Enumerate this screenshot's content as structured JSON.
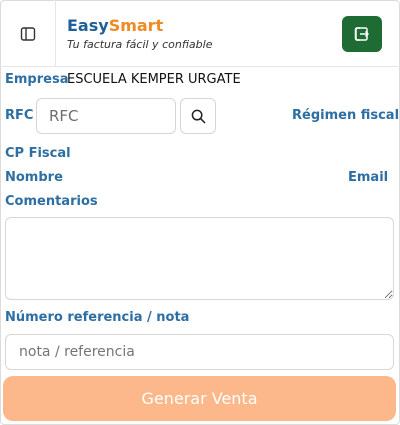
{
  "header": {
    "brand_easy": "Easy",
    "brand_smart": "Smart",
    "tagline": "Tu factura fácil y confiable",
    "toggle_icon": "sidebar-toggle-icon",
    "logout_icon": "logout-icon"
  },
  "form": {
    "empresa_label": "Empresa",
    "empresa_value": "ESCUELA KEMPER URGATE",
    "rfc_label": "RFC",
    "rfc_placeholder": "RFC",
    "regimen_label": "Régimen fiscal",
    "cp_label": "CP Fiscal",
    "nombre_label": "Nombre",
    "email_label": "Email",
    "comentarios_label": "Comentarios",
    "comentarios_value": "",
    "nota_label": "Número referencia / nota",
    "nota_placeholder": "nota / referencia",
    "submit_label": "Generar Venta"
  },
  "colors": {
    "brand_blue": "#1f5f99",
    "brand_orange": "#f08a24",
    "label_blue": "#2d6ea3",
    "logout_green": "#1e6b34",
    "submit_disabled": "#fcb88a"
  }
}
